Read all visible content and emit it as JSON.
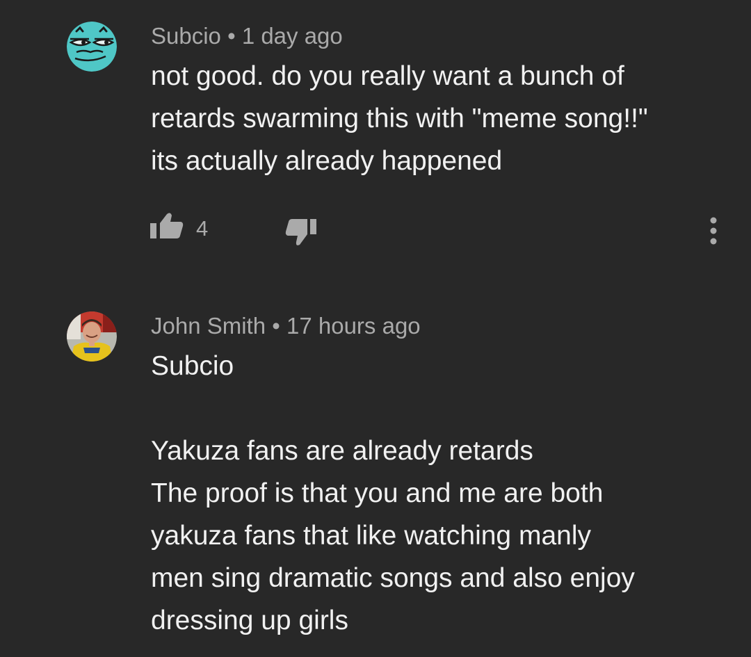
{
  "comments": [
    {
      "author": "Subcio",
      "separator": "•",
      "time": "1 day ago",
      "text": "not good. do you really want a bunch of\nretards swarming this with \"meme song!!\"\nits actually already happened",
      "likes": "4",
      "avatar_icon": "cartoon-face-avatar",
      "avatar_color": "#4fc7c6"
    },
    {
      "author": "John Smith",
      "separator": "•",
      "time": "17 hours ago",
      "text": "Subcio\n\nYakuza fans are already retards\nThe proof is that you and me are both\nyakuza fans that like watching manly\nmen sing dramatic songs and also enjoy\ndressing up girls",
      "avatar_icon": "photo-avatar"
    }
  ],
  "icons": {
    "like": "thumbs-up-icon",
    "dislike": "thumbs-down-icon",
    "more": "more-vertical-icon"
  },
  "colors": {
    "background": "#282828",
    "primary_text": "#f1f1f1",
    "secondary_text": "#aaaaaa"
  }
}
